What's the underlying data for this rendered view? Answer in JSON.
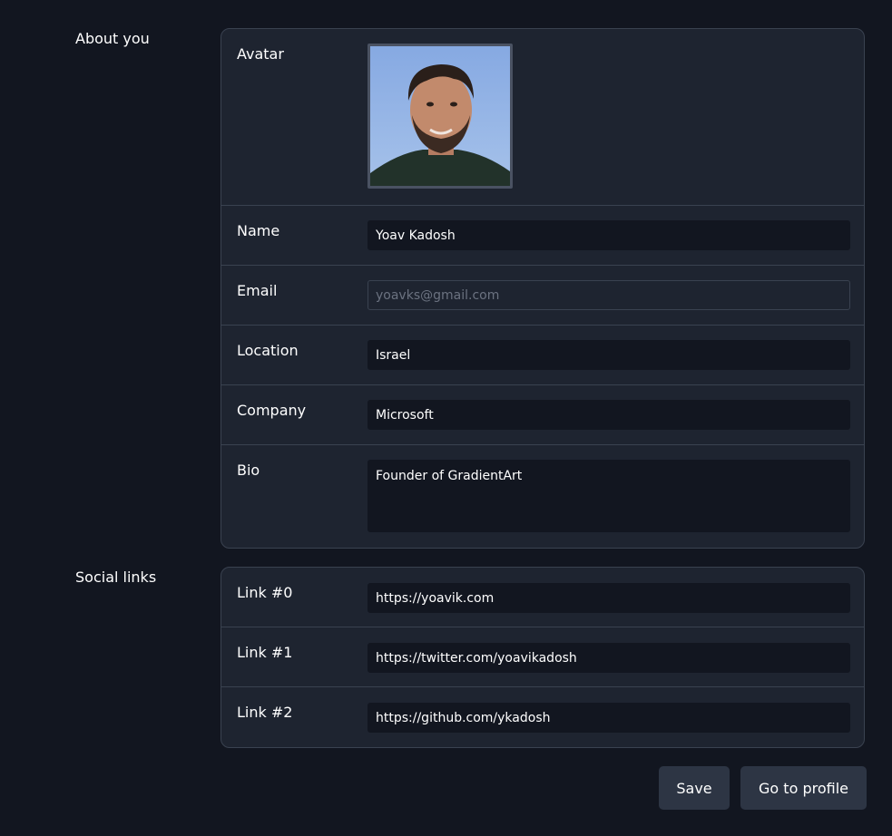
{
  "about": {
    "section_label": "About you",
    "avatar_label": "Avatar",
    "name_label": "Name",
    "name_value": "Yoav Kadosh",
    "email_label": "Email",
    "email_value": "yoavks@gmail.com",
    "location_label": "Location",
    "location_value": "Israel",
    "company_label": "Company",
    "company_value": "Microsoft",
    "bio_label": "Bio",
    "bio_value": "Founder of GradientArt"
  },
  "social": {
    "section_label": "Social links",
    "links": [
      {
        "label": "Link #0",
        "value": "https://yoavik.com"
      },
      {
        "label": "Link #1",
        "value": "https://twitter.com/yoavikadosh"
      },
      {
        "label": "Link #2",
        "value": "https://github.com/ykadosh"
      }
    ]
  },
  "actions": {
    "save_label": "Save",
    "profile_label": "Go to profile"
  },
  "colors": {
    "background": "#121620",
    "card": "#1e2430",
    "border": "#3a4250",
    "button": "#2d3544"
  }
}
